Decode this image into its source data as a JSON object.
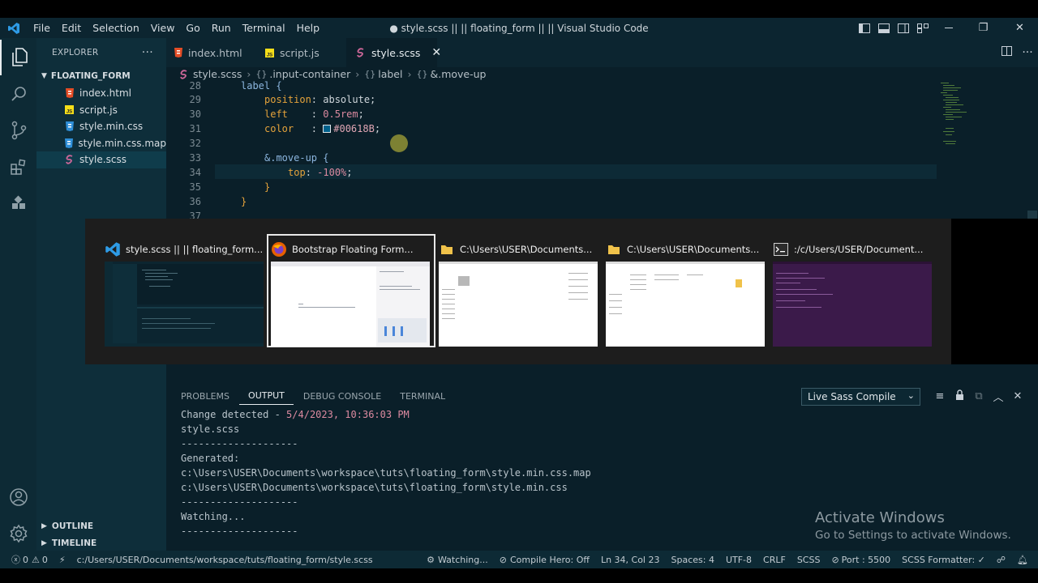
{
  "window": {
    "title": "● style.scss || || floating_form || || Visual Studio Code",
    "menu": [
      "File",
      "Edit",
      "Selection",
      "View",
      "Go",
      "Run",
      "Terminal",
      "Help"
    ],
    "restore_glyph": "❐",
    "close_glyph": "✕"
  },
  "sidebar": {
    "header": "EXPLORER",
    "more": "···",
    "folder": "FLOATING_FORM",
    "files": [
      {
        "name": "index.html",
        "icon": "html-icon"
      },
      {
        "name": "script.js",
        "icon": "js-icon"
      },
      {
        "name": "style.min.css",
        "icon": "css-icon"
      },
      {
        "name": "style.min.css.map",
        "icon": "css-icon"
      },
      {
        "name": "style.scss",
        "icon": "sass-icon",
        "active": true
      }
    ],
    "outline": "OUTLINE",
    "timeline": "TIMELINE"
  },
  "tabs": [
    {
      "label": "index.html",
      "icon": "html-icon"
    },
    {
      "label": "script.js",
      "icon": "js-icon"
    },
    {
      "label": "style.scss",
      "icon": "sass-icon",
      "active": true,
      "close": "✕"
    }
  ],
  "breadcrumb": [
    "style.scss",
    ".input-container",
    "label",
    "&.move-up"
  ],
  "editor": {
    "lines": [
      {
        "n": "28",
        "code": "label {"
      },
      {
        "n": "29",
        "prop": "position",
        "sep": ": ",
        "val": "absolute",
        "end": ";"
      },
      {
        "n": "30",
        "prop": "left",
        "sep": "    : ",
        "val": "0.5rem",
        "end": ";"
      },
      {
        "n": "31",
        "prop": "color",
        "sep": "   : ",
        "val": "#00618B",
        "end": ";"
      },
      {
        "n": "32",
        "code": ""
      },
      {
        "n": "33",
        "code": "&.move-up {"
      },
      {
        "n": "34",
        "prop": "top",
        "sep": ": ",
        "val": "-100%",
        "end": ";"
      },
      {
        "n": "35",
        "code": "}"
      },
      {
        "n": "36",
        "code": "}"
      },
      {
        "n": "37",
        "code": ""
      }
    ],
    "swatch_color": "#00618B"
  },
  "switcher": {
    "windows": [
      {
        "title": "style.scss || || floating_form...",
        "icon": "vscode-icon"
      },
      {
        "title": "Bootstrap Floating Form...",
        "icon": "firefox-icon",
        "selected": true
      },
      {
        "title": "C:\\Users\\USER\\Documents...",
        "icon": "folder-icon"
      },
      {
        "title": "C:\\Users\\USER\\Documents...",
        "icon": "folder-icon"
      },
      {
        "title": ":/c/Users/USER/Document...",
        "icon": "terminal-icon"
      }
    ]
  },
  "panel": {
    "tabs": [
      "PROBLEMS",
      "OUTPUT",
      "DEBUG CONSOLE",
      "TERMINAL"
    ],
    "active_tab": "OUTPUT",
    "channel": "Live Sass Compile",
    "output": {
      "change_prefix": "Change detected - ",
      "change_date": "5/4/2023, 10:36:03 PM",
      "file": "style.scss",
      "divider": "--------------------",
      "generated": "Generated:",
      "path1": "c:\\Users\\USER\\Documents\\workspace\\tuts\\floating_form\\style.min.css.map",
      "path2": "c:\\Users\\USER\\Documents\\workspace\\tuts\\floating_form\\style.min.css",
      "watching": "Watching..."
    }
  },
  "watermark": {
    "line1": "Activate Windows",
    "line2": "Go to Settings to activate Windows."
  },
  "statusbar": {
    "errors": "0",
    "warnings": "0",
    "path": "c:/Users/USER/Documents/workspace/tuts/floating_form/style.scss",
    "watching": "Watching...",
    "compile_hero": "Compile Hero: Off",
    "position": "Ln 34, Col 23",
    "spaces": "Spaces: 4",
    "encoding": "UTF-8",
    "eol": "CRLF",
    "language": "SCSS",
    "port": "Port : 5500",
    "formatter": "SCSS Formatter: ✓"
  },
  "colors": {
    "accent": "#007acc",
    "sass": "#cd6799",
    "html": "#e44d26",
    "js": "#f5de19",
    "css": "#2f8fd8"
  }
}
